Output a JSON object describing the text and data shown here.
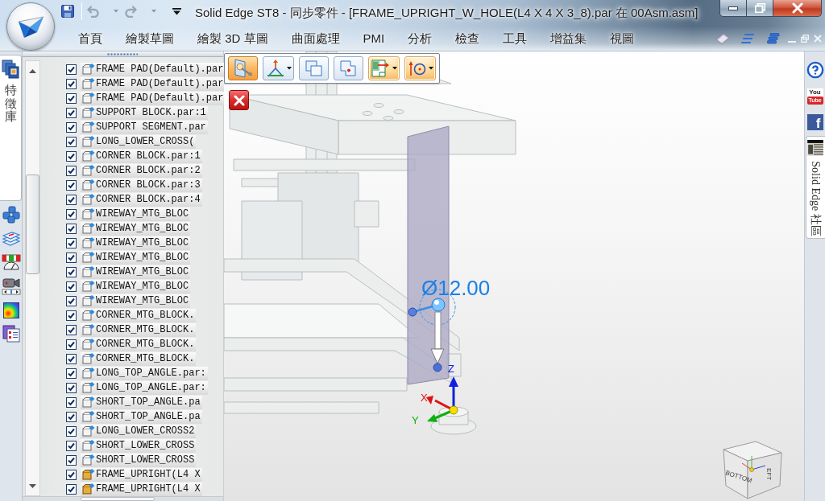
{
  "window": {
    "title": "Solid Edge ST8 - 同步零件 - [FRAME_UPRIGHT_W_HOLE(L4 X 4 X 3_8).par 在 00Asm.asm]"
  },
  "quick_access": [
    {
      "kind": "save",
      "disabled": false
    },
    {
      "kind": "undo",
      "disabled": true
    },
    {
      "kind": "redo",
      "disabled": true
    }
  ],
  "ribbon": {
    "tabs": [
      {
        "label": "首頁",
        "selected": false
      },
      {
        "label": "繪製草圖",
        "selected": false
      },
      {
        "label": "繪製 3D 草圖",
        "selected": false
      },
      {
        "label": "曲面處理",
        "selected": false
      },
      {
        "label": "PMI",
        "selected": false
      },
      {
        "label": "分析",
        "selected": false
      },
      {
        "label": "檢查",
        "selected": false
      },
      {
        "label": "工具",
        "selected": false
      },
      {
        "label": "增益集",
        "selected": false
      },
      {
        "label": "視圖",
        "selected": false
      }
    ]
  },
  "side_tab": {
    "label": "特徵庫",
    "selected": true
  },
  "tree": {
    "rows": [
      {
        "label": "FRAME PAD(Default).par",
        "checked": true,
        "kind": "part"
      },
      {
        "label": "FRAME PAD(Default).par",
        "checked": true,
        "kind": "part"
      },
      {
        "label": "FRAME PAD(Default).par",
        "checked": true,
        "kind": "part"
      },
      {
        "label": "SUPPORT BLOCK.par:1",
        "checked": true,
        "kind": "part"
      },
      {
        "label": "SUPPORT SEGMENT.par",
        "checked": true,
        "kind": "part"
      },
      {
        "label": "LONG_LOWER_CROSS(",
        "checked": true,
        "kind": "part"
      },
      {
        "label": "CORNER BLOCK.par:1",
        "checked": true,
        "kind": "part"
      },
      {
        "label": "CORNER BLOCK.par:2",
        "checked": true,
        "kind": "part"
      },
      {
        "label": "CORNER BLOCK.par:3",
        "checked": true,
        "kind": "part"
      },
      {
        "label": "CORNER BLOCK.par:4",
        "checked": true,
        "kind": "part"
      },
      {
        "label": "WIREWAY_MTG_BLOC",
        "checked": true,
        "kind": "part"
      },
      {
        "label": "WIREWAY_MTG_BLOC",
        "checked": true,
        "kind": "part"
      },
      {
        "label": "WIREWAY_MTG_BLOC",
        "checked": true,
        "kind": "part"
      },
      {
        "label": "WIREWAY_MTG_BLOC",
        "checked": true,
        "kind": "part"
      },
      {
        "label": "WIREWAY_MTG_BLOC",
        "checked": true,
        "kind": "part"
      },
      {
        "label": "WIREWAY_MTG_BLOC",
        "checked": true,
        "kind": "part"
      },
      {
        "label": "WIREWAY_MTG_BLOC",
        "checked": true,
        "kind": "part"
      },
      {
        "label": "CORNER_MTG_BLOCK.",
        "checked": true,
        "kind": "part"
      },
      {
        "label": "CORNER_MTG_BLOCK.",
        "checked": true,
        "kind": "part"
      },
      {
        "label": "CORNER_MTG_BLOCK.",
        "checked": true,
        "kind": "part"
      },
      {
        "label": "CORNER_MTG_BLOCK.",
        "checked": true,
        "kind": "part"
      },
      {
        "label": "LONG_TOP_ANGLE.par:",
        "checked": true,
        "kind": "part"
      },
      {
        "label": "LONG_TOP_ANGLE.par:",
        "checked": true,
        "kind": "part"
      },
      {
        "label": "SHORT_TOP_ANGLE.pa",
        "checked": true,
        "kind": "part"
      },
      {
        "label": "SHORT_TOP_ANGLE.pa",
        "checked": true,
        "kind": "part"
      },
      {
        "label": "LONG_LOWER_CROSS2",
        "checked": true,
        "kind": "part"
      },
      {
        "label": "SHORT_LOWER_CROSS",
        "checked": true,
        "kind": "part"
      },
      {
        "label": "SHORT_LOWER_CROSS",
        "checked": true,
        "kind": "part"
      },
      {
        "label": "FRAME_UPRIGHT(L4 X",
        "checked": true,
        "kind": "frame"
      },
      {
        "label": "FRAME_UPRIGHT(L4 X",
        "checked": true,
        "kind": "frame"
      }
    ]
  },
  "command_bar": {
    "buttons": [
      {
        "selected": true,
        "on": false,
        "menu": false
      },
      {
        "selected": false,
        "on": false,
        "menu": true
      },
      {
        "selected": false,
        "on": false,
        "menu": false
      },
      {
        "selected": false,
        "on": false,
        "menu": false
      },
      {
        "selected": false,
        "on": true,
        "menu": true
      },
      {
        "selected": false,
        "on": true,
        "menu": true
      }
    ]
  },
  "viewport": {
    "dimension": "Ø12.00",
    "triad": {
      "x": "X",
      "y": "Y",
      "z": "Z"
    },
    "view_cube": {
      "faces": [
        "BOTTOM",
        "EFT"
      ]
    }
  },
  "right_strip": {
    "youtube": [
      "You",
      "Tube"
    ],
    "facebook": "f",
    "community_tab": {
      "label": "Solid Edge 社區"
    }
  }
}
